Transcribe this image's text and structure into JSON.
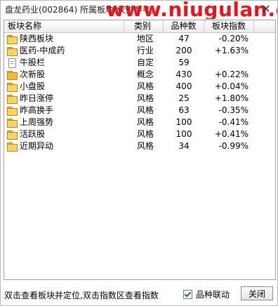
{
  "window": {
    "title": "盘龙药业(002864) 所属板块(仅供参考)",
    "watermark": "www.niugulan.com",
    "close_glyph": "✕"
  },
  "table": {
    "columns": [
      "板块名称",
      "类别",
      "品种数",
      "板块指数"
    ],
    "rows": [
      {
        "name": "陕西板块",
        "type": "地区",
        "count": "47",
        "index": "-0.20%",
        "icon": "folder-icon"
      },
      {
        "name": "医药-中成药",
        "type": "行业",
        "count": "200",
        "index": "+1.63%",
        "icon": "folder-icon"
      },
      {
        "name": "牛股栏",
        "type": "自定",
        "count": "59",
        "index": "",
        "icon": "document-icon"
      },
      {
        "name": "次新股",
        "type": "概念",
        "count": "430",
        "index": "+0.22%",
        "icon": "folder-open-icon"
      },
      {
        "name": "小盘股",
        "type": "风格",
        "count": "400",
        "index": "+0.04%",
        "icon": "folder-icon"
      },
      {
        "name": "昨日涨停",
        "type": "风格",
        "count": "25",
        "index": "+1.80%",
        "icon": "folder-icon"
      },
      {
        "name": "昨高换手",
        "type": "风格",
        "count": "63",
        "index": "-0.35%",
        "icon": "folder-icon"
      },
      {
        "name": "上周强势",
        "type": "风格",
        "count": "100",
        "index": "-0.41%",
        "icon": "folder-icon"
      },
      {
        "name": "活跃股",
        "type": "风格",
        "count": "100",
        "index": "+0.41%",
        "icon": "folder-icon"
      },
      {
        "name": "近期异动",
        "type": "风格",
        "count": "34",
        "index": "-0.99%",
        "icon": "folder-icon"
      }
    ]
  },
  "footer": {
    "hint": "双击查看板块并定位,双击指数区查看指数",
    "checkbox_label": "品种联动",
    "checkbox_checked": true,
    "close_label": "关闭"
  }
}
